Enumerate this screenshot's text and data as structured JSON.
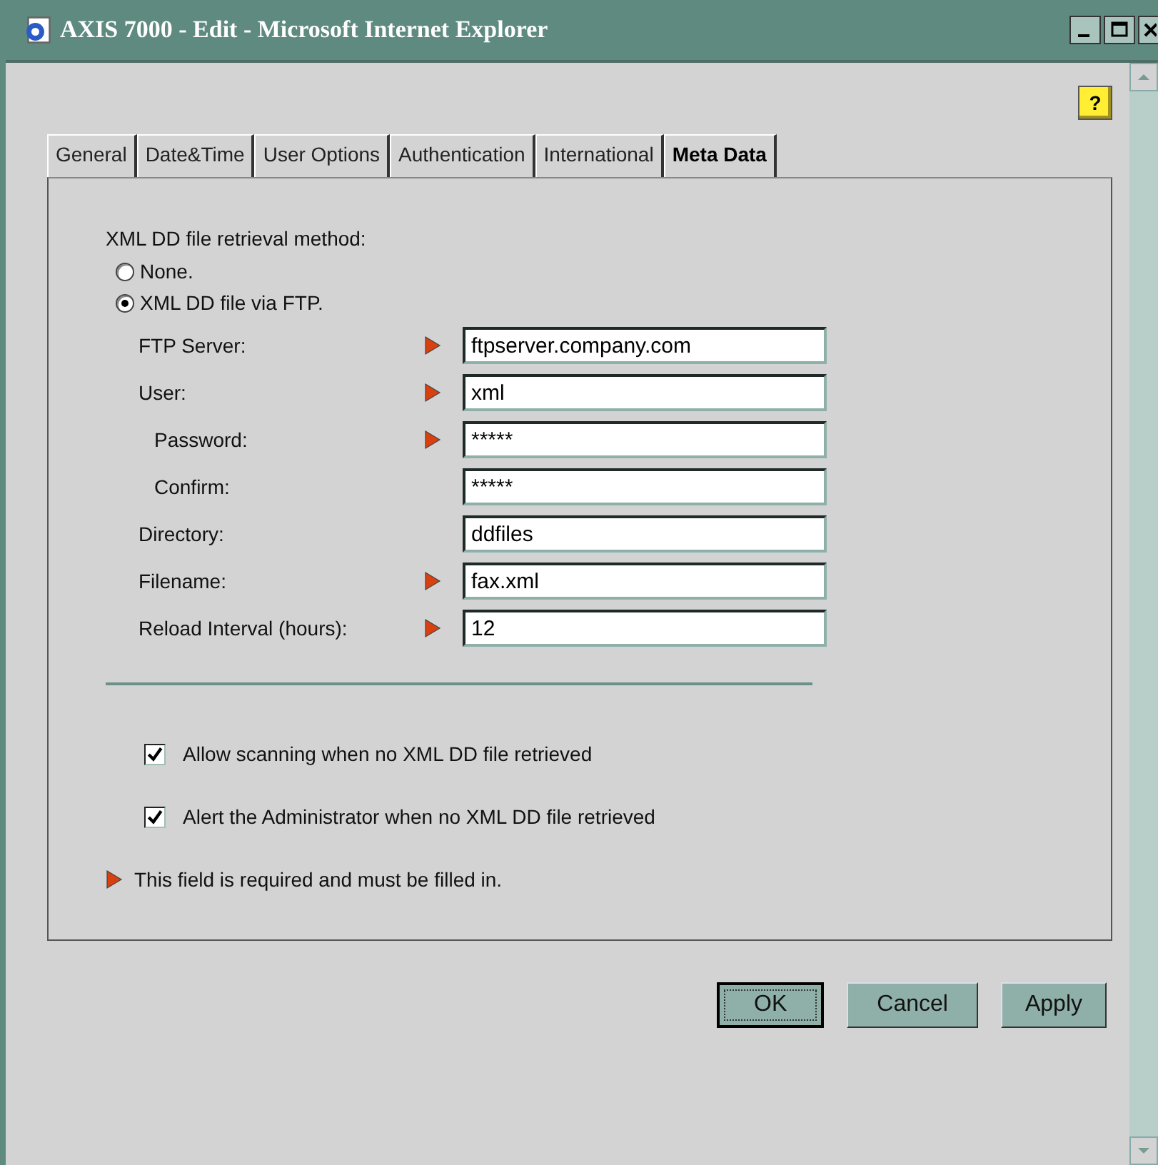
{
  "window": {
    "title": "AXIS 7000 - Edit - Microsoft Internet Explorer"
  },
  "help_button": {
    "label": "?"
  },
  "tabs": [
    {
      "label": "General",
      "selected": false
    },
    {
      "label": "Date&Time",
      "selected": false
    },
    {
      "label": "User Options",
      "selected": false
    },
    {
      "label": "Authentication",
      "selected": false
    },
    {
      "label": "International",
      "selected": false
    },
    {
      "label": "Meta Data",
      "selected": true
    }
  ],
  "retrieval": {
    "heading": "XML DD file retrieval method:",
    "options": [
      {
        "label": "None.",
        "selected": false
      },
      {
        "label": "XML DD file via FTP.",
        "selected": true
      }
    ]
  },
  "fields": [
    {
      "label": "FTP Server:",
      "required": true,
      "indented": false,
      "value": "ftpserver.company.com"
    },
    {
      "label": "User:",
      "required": true,
      "indented": false,
      "value": "xml"
    },
    {
      "label": "Password:",
      "required": true,
      "indented": true,
      "value": "*****"
    },
    {
      "label": "Confirm:",
      "required": false,
      "indented": true,
      "value": "*****"
    },
    {
      "label": "Directory:",
      "required": false,
      "indented": false,
      "value": "ddfiles"
    },
    {
      "label": "Filename:",
      "required": true,
      "indented": false,
      "value": "fax.xml"
    },
    {
      "label": "Reload Interval (hours):",
      "required": true,
      "indented": false,
      "value": "12"
    }
  ],
  "checkboxes": [
    {
      "label": "Allow scanning when no XML DD file retrieved",
      "checked": true
    },
    {
      "label": "Alert the Administrator when no XML DD file retrieved",
      "checked": true
    }
  ],
  "required_note": "This field is required and must be filled in.",
  "buttons": [
    {
      "label": "OK",
      "default": true
    },
    {
      "label": "Cancel",
      "default": false
    },
    {
      "label": "Apply",
      "default": false
    }
  ]
}
